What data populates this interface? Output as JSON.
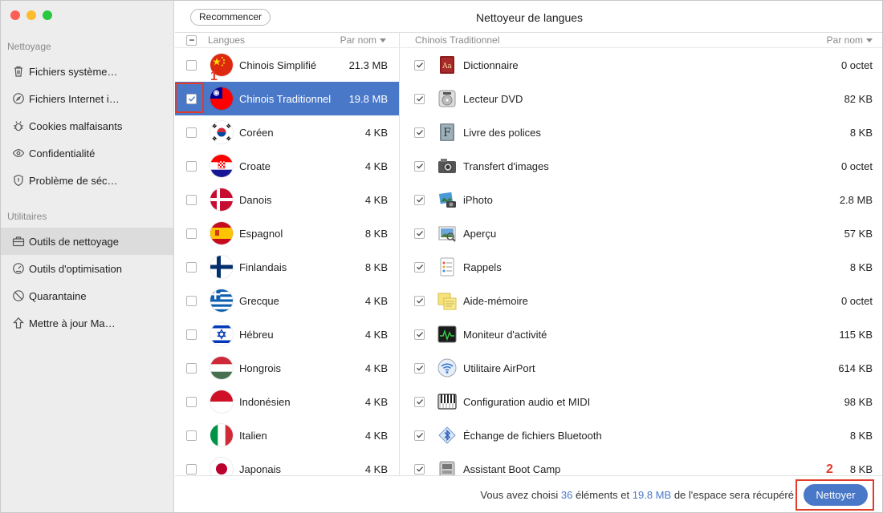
{
  "window": {
    "title": "Nettoyeur de langues",
    "restart_label": "Recommencer",
    "traffic_colors": [
      "#fc5f57",
      "#fdbc2e",
      "#28c840"
    ]
  },
  "sidebar": {
    "section1_title": "Nettoyage",
    "section1_items": [
      {
        "label": "Fichiers système…",
        "icon": "trash-icon"
      },
      {
        "label": "Fichiers Internet i…",
        "icon": "compass-icon"
      },
      {
        "label": "Cookies malfaisants",
        "icon": "bug-icon"
      },
      {
        "label": "Confidentialité",
        "icon": "eye-icon"
      },
      {
        "label": "Problème de séc…",
        "icon": "shield-icon"
      }
    ],
    "section2_title": "Utilitaires",
    "section2_items": [
      {
        "label": "Outils de nettoyage",
        "icon": "toolbox-icon",
        "active": true
      },
      {
        "label": "Outils d'optimisation",
        "icon": "gauge-icon"
      },
      {
        "label": "Quarantaine",
        "icon": "ban-icon"
      },
      {
        "label": "Mettre à jour Ma…",
        "icon": "upload-icon"
      }
    ]
  },
  "languages_panel": {
    "header": "Langues",
    "sort_label": "Par nom",
    "items": [
      {
        "name": "Chinois Simplifié",
        "size": "21.3 MB",
        "checked": false,
        "flag": "china"
      },
      {
        "name": "Chinois Traditionnel",
        "size": "19.8 MB",
        "checked": true,
        "selected": true,
        "flag": "taiwan"
      },
      {
        "name": "Coréen",
        "size": "4 KB",
        "checked": false,
        "flag": "korea"
      },
      {
        "name": "Croate",
        "size": "4 KB",
        "checked": false,
        "flag": "croatia"
      },
      {
        "name": "Danois",
        "size": "4 KB",
        "checked": false,
        "flag": "denmark"
      },
      {
        "name": "Espagnol",
        "size": "8 KB",
        "checked": false,
        "flag": "spain"
      },
      {
        "name": "Finlandais",
        "size": "8 KB",
        "checked": false,
        "flag": "finland"
      },
      {
        "name": "Grecque",
        "size": "4 KB",
        "checked": false,
        "flag": "greece"
      },
      {
        "name": "Hébreu",
        "size": "4 KB",
        "checked": false,
        "flag": "israel"
      },
      {
        "name": "Hongrois",
        "size": "4 KB",
        "checked": false,
        "flag": "hungary"
      },
      {
        "name": "Indonésien",
        "size": "4 KB",
        "checked": false,
        "flag": "indonesia"
      },
      {
        "name": "Italien",
        "size": "4 KB",
        "checked": false,
        "flag": "italy"
      },
      {
        "name": "Japonais",
        "size": "4 KB",
        "checked": false,
        "flag": "japan"
      }
    ]
  },
  "apps_panel": {
    "header": "Chinois Traditionnel",
    "sort_label": "Par nom",
    "items": [
      {
        "name": "Dictionnaire",
        "size": "0 octet",
        "icon": "dictionary-icon"
      },
      {
        "name": "Lecteur DVD",
        "size": "82 KB",
        "icon": "dvd-icon"
      },
      {
        "name": "Livre des polices",
        "size": "8 KB",
        "icon": "fontbook-icon"
      },
      {
        "name": "Transfert d'images",
        "size": "0 octet",
        "icon": "camera-icon"
      },
      {
        "name": "iPhoto",
        "size": "2.8 MB",
        "icon": "iphoto-icon"
      },
      {
        "name": "Aperçu",
        "size": "57 KB",
        "icon": "preview-icon"
      },
      {
        "name": "Rappels",
        "size": "8 KB",
        "icon": "reminders-icon"
      },
      {
        "name": "Aide-mémoire",
        "size": "0 octet",
        "icon": "stickies-icon"
      },
      {
        "name": "Moniteur d'activité",
        "size": "115 KB",
        "icon": "activity-monitor-icon"
      },
      {
        "name": "Utilitaire AirPort",
        "size": "614 KB",
        "icon": "airport-icon"
      },
      {
        "name": "Configuration audio et MIDI",
        "size": "98 KB",
        "icon": "midi-icon"
      },
      {
        "name": "Échange de fichiers Bluetooth",
        "size": "8 KB",
        "icon": "bluetooth-icon"
      },
      {
        "name": "Assistant Boot Camp",
        "size": "8 KB",
        "icon": "bootcamp-icon"
      }
    ]
  },
  "footer": {
    "text_before": "Vous avez choisi",
    "count": "36",
    "text_middle": "éléments et",
    "size": "19.8 MB",
    "text_after": "de l'espace sera récupéré",
    "button_label": "Nettoyer"
  },
  "annotations": {
    "step1": "1",
    "step2": "2",
    "color": "#e23b2a"
  }
}
